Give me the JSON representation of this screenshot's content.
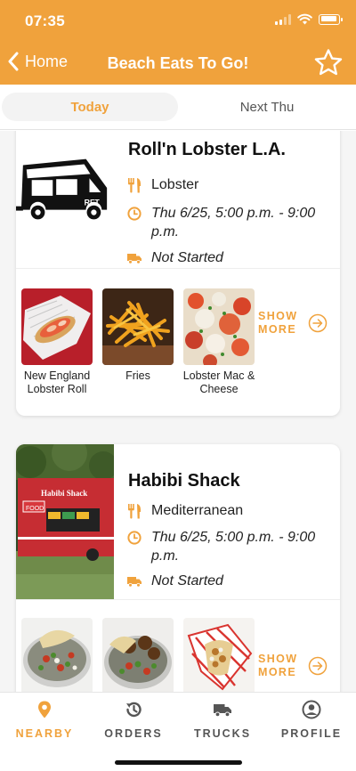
{
  "status_bar": {
    "time": "07:35"
  },
  "nav": {
    "back_label": "Home",
    "title": "Beach Eats To Go!"
  },
  "tabs": [
    {
      "label": "Today",
      "active": true
    },
    {
      "label": "Next Thu",
      "active": false
    }
  ],
  "trucks": [
    {
      "name": "Roll'n Lobster L.A.",
      "cuisine": "Lobster",
      "schedule": "Thu 6/25, 5:00 p.m. - 9:00 p.m.",
      "status": "Not Started",
      "image_icon": "food-truck-icon",
      "truck_decal": "RFT",
      "menu": [
        {
          "label": "New England Lobster Roll"
        },
        {
          "label": "Fries"
        },
        {
          "label": "Lobster Mac & Cheese"
        }
      ],
      "show_more": "SHOW MORE"
    },
    {
      "name": "Habibi Shack",
      "cuisine": "Mediterranean",
      "schedule": "Thu 6/25, 5:00 p.m. - 9:00 p.m.",
      "status": "Not Started",
      "image_sign": "Habibi Shack",
      "image_panel": "FOOD",
      "menu": [
        {
          "label": ""
        },
        {
          "label": ""
        },
        {
          "label": ""
        }
      ],
      "show_more": "SHOW MORE"
    }
  ],
  "bottom_nav": [
    {
      "label": "NEARBY",
      "icon": "location-pin-icon",
      "active": true
    },
    {
      "label": "ORDERS",
      "icon": "history-icon",
      "active": false
    },
    {
      "label": "TRUCKS",
      "icon": "truck-icon",
      "active": false
    },
    {
      "label": "PROFILE",
      "icon": "profile-icon",
      "active": false
    }
  ],
  "colors": {
    "accent": "#f0a23c",
    "text": "#111111",
    "muted": "#555555"
  }
}
